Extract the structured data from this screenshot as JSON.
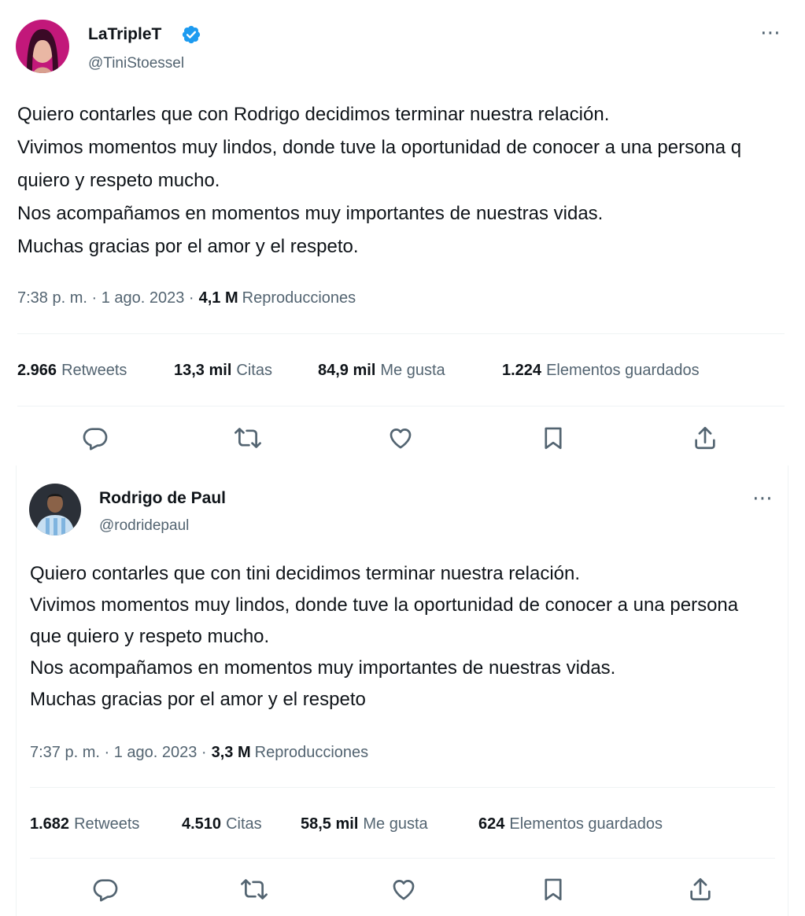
{
  "tweets": [
    {
      "author_name": "LaTripleT",
      "verified": true,
      "handle": "@TiniStoessel",
      "text": "Quiero contarles que con Rodrigo decidimos terminar nuestra relación.\nVivimos momentos muy lindos, donde tuve la oportunidad de conocer a una persona q quiero y respeto mucho.\nNos acompañamos en momentos muy importantes de nuestras vidas.\nMuchas gracias por el amor y el respeto.",
      "time": "7:38 p. m. · 1 ago. 2023 ·",
      "views_count": "4,1 M",
      "views_label": "Reproducciones",
      "stats": [
        {
          "count": "2.966",
          "label": "Retweets"
        },
        {
          "count": "13,3 mil",
          "label": "Citas"
        },
        {
          "count": "84,9 mil",
          "label": "Me gusta"
        },
        {
          "count": "1.224",
          "label": "Elementos guardados"
        }
      ],
      "more_icon": "⋯"
    },
    {
      "author_name": "Rodrigo de Paul",
      "verified": false,
      "handle": "@rodridepaul",
      "text": "Quiero contarles que con tini decidimos terminar nuestra relación.\nVivimos momentos muy lindos, donde tuve la oportunidad de conocer a una persona que quiero y respeto mucho.\nNos acompañamos en momentos muy importantes de nuestras vidas.\nMuchas gracias por el amor y el respeto",
      "time": "7:37 p. m. · 1 ago. 2023 ·",
      "views_count": "3,3 M",
      "views_label": "Reproducciones",
      "stats": [
        {
          "count": "1.682",
          "label": "Retweets"
        },
        {
          "count": "4.510",
          "label": "Citas"
        },
        {
          "count": "58,5 mil",
          "label": "Me gusta"
        },
        {
          "count": "624",
          "label": "Elementos guardados"
        }
      ],
      "more_icon": "⋯"
    }
  ],
  "colors": {
    "verified_blue": "#1d9bf0",
    "text_primary": "#0f1419",
    "text_secondary": "#536471",
    "divider": "#eff3f4"
  },
  "action_icons": [
    "reply-icon",
    "retweet-icon",
    "like-icon",
    "bookmark-icon",
    "share-icon"
  ]
}
